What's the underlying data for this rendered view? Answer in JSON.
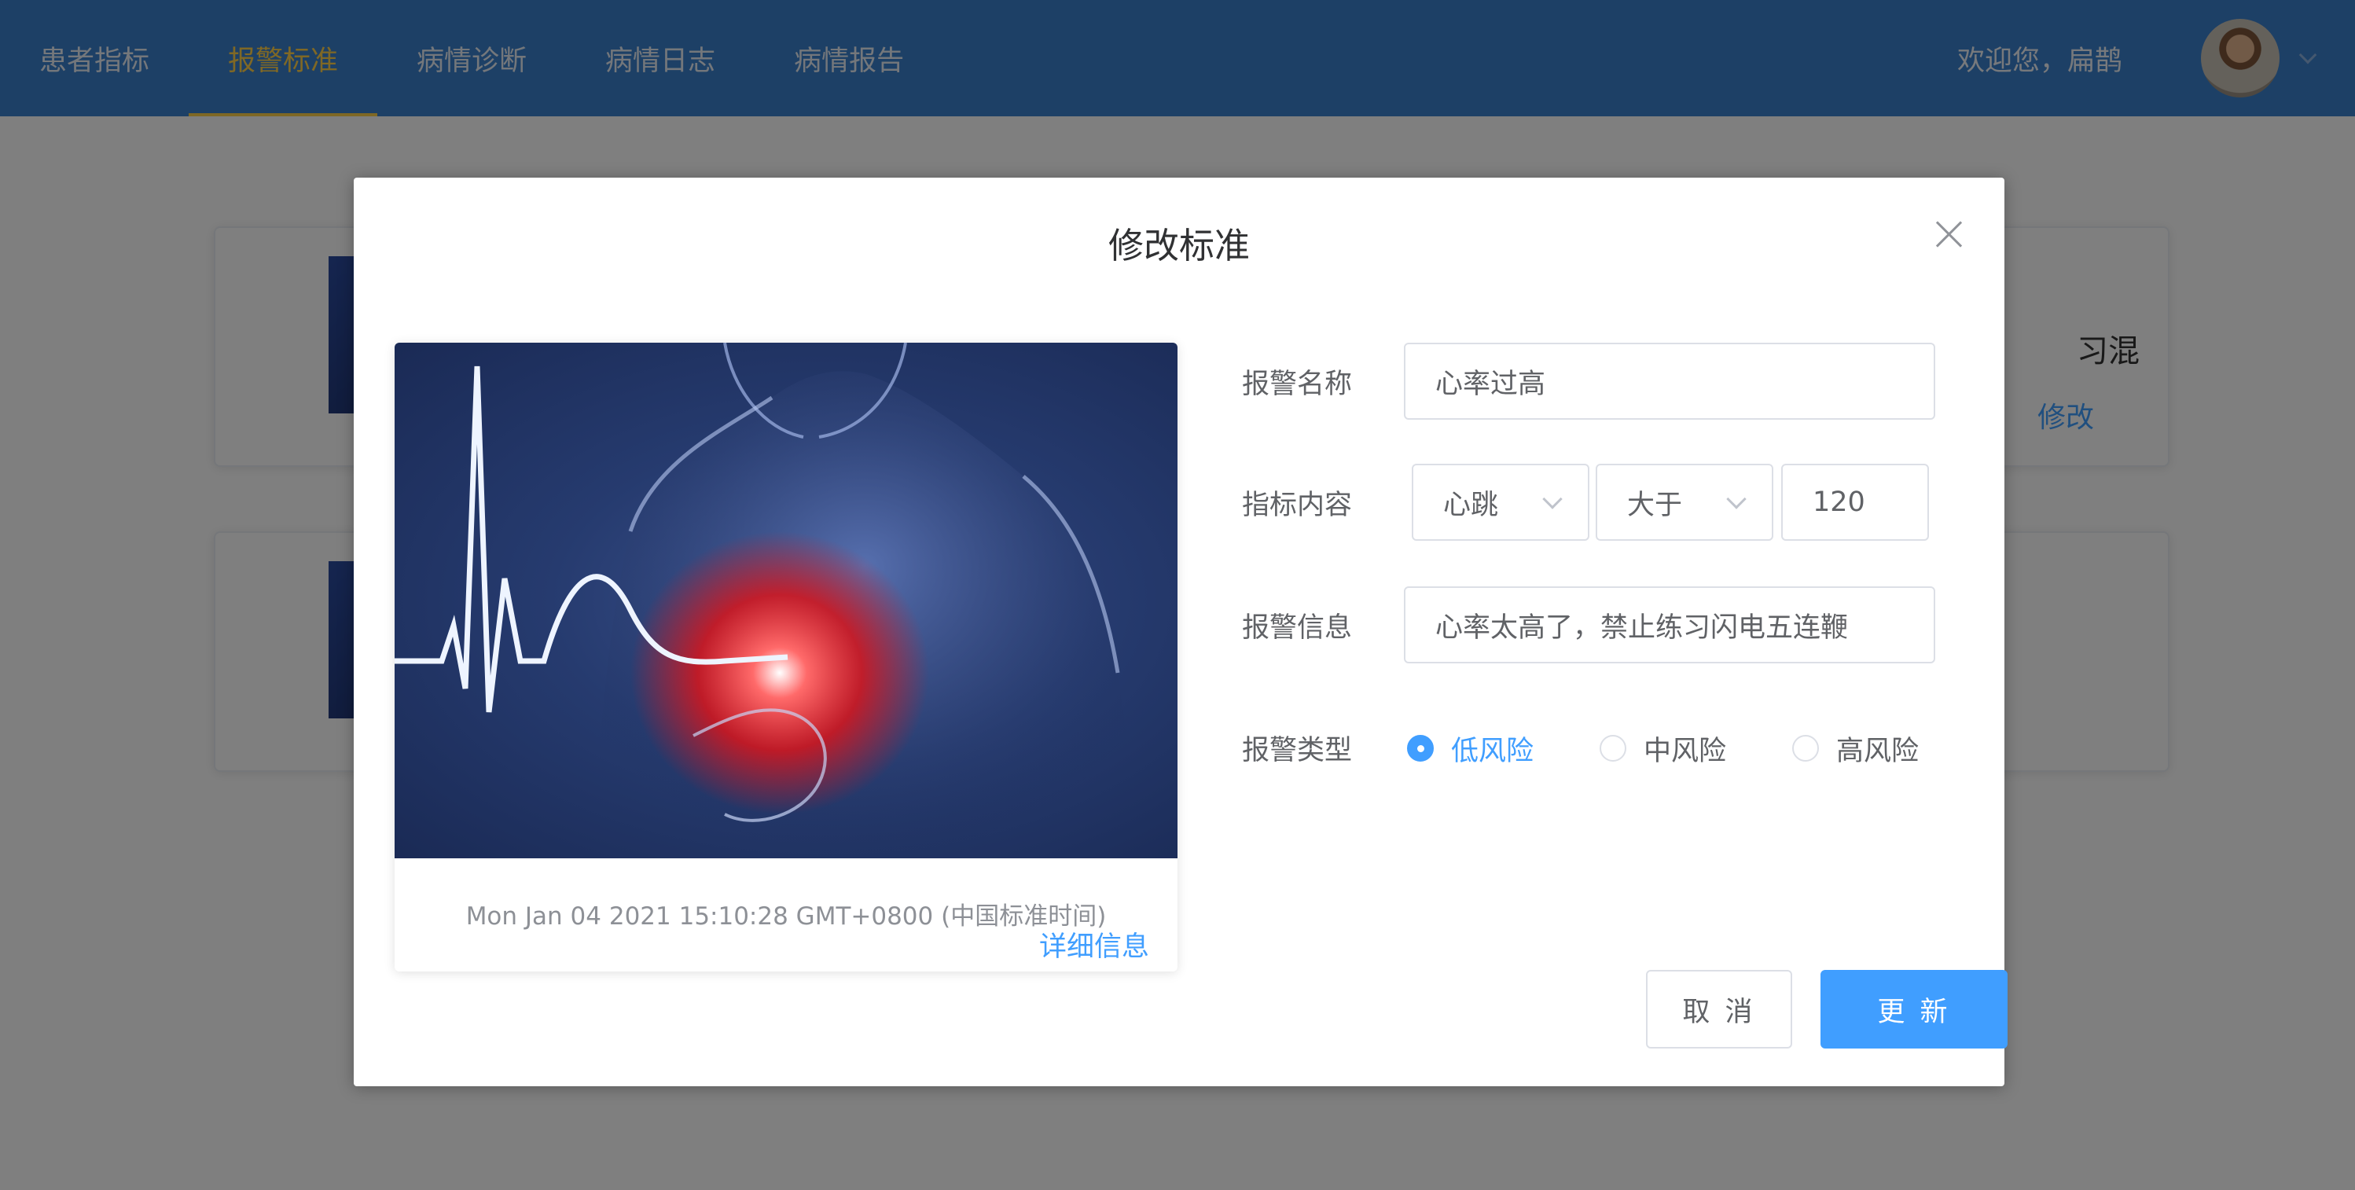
{
  "nav": {
    "tabs": [
      {
        "label": "患者指标",
        "active": false
      },
      {
        "label": "报警标准",
        "active": true
      },
      {
        "label": "病情诊断",
        "active": false
      },
      {
        "label": "病情日志",
        "active": false
      },
      {
        "label": "病情报告",
        "active": false
      }
    ],
    "welcome": "欢迎您，扁鹊"
  },
  "background": {
    "card_text_fragment": "习混",
    "card_edit_link": "修改"
  },
  "dialog": {
    "title": "修改标准",
    "image_card": {
      "date": "Mon Jan 04 2021 15:10:28 GMT+0800 (中国标准时间)",
      "detail_link": "详细信息"
    },
    "form": {
      "name_label": "报警名称",
      "name_value": "心率过高",
      "indicator_label": "指标内容",
      "indicator_metric": "心跳",
      "indicator_operator": "大于",
      "indicator_threshold": "120",
      "message_label": "报警信息",
      "message_value": "心率太高了，禁止练习闪电五连鞭",
      "type_label": "报警类型",
      "risk_options": [
        {
          "label": "低风险",
          "checked": true
        },
        {
          "label": "中风险",
          "checked": false
        },
        {
          "label": "高风险",
          "checked": false
        }
      ]
    },
    "buttons": {
      "cancel": "取 消",
      "update": "更 新"
    }
  },
  "colors": {
    "navbar": "#3a80cc",
    "nav_active": "#ffd04b",
    "primary": "#409eff"
  }
}
